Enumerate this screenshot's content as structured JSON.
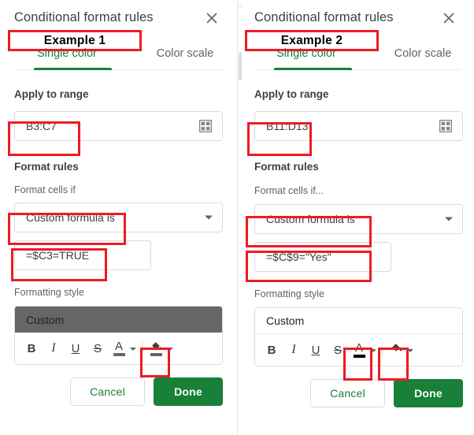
{
  "panels": [
    {
      "id": "example-1",
      "title": "Conditional format rules",
      "close_icon": "close-icon",
      "callout": "Example 1",
      "tabs": [
        {
          "label": "Single color",
          "active": true
        },
        {
          "label": "Color scale",
          "active": false
        }
      ],
      "apply_to_range": {
        "label": "Apply to range",
        "value": "B3:C7",
        "picker_icon": "grid-picker-icon"
      },
      "format_rules": {
        "heading": "Format rules",
        "condition_label": "Format cells if",
        "condition_value": "Custom formula is",
        "formula_value": "=$C3=TRUE"
      },
      "formatting_style": {
        "label": "Formatting style",
        "preview_text": "Custom",
        "preview_bg": "#666666",
        "preview_fg": "#202124",
        "tools": [
          "B",
          "I",
          "U",
          "S"
        ],
        "text_color_icon": "text-color-icon",
        "text_color_swatch": "#666666",
        "fill_color_icon": "fill-color-icon",
        "fill_color_swatch": "#666666"
      },
      "buttons": {
        "cancel": "Cancel",
        "done": "Done"
      }
    },
    {
      "id": "example-2",
      "title": "Conditional format rules",
      "close_icon": "close-icon",
      "callout": "Example 2",
      "tabs": [
        {
          "label": "Single color",
          "active": true
        },
        {
          "label": "Color scale",
          "active": false
        }
      ],
      "apply_to_range": {
        "label": "Apply to range",
        "value": "B11:D13",
        "picker_icon": "grid-picker-icon"
      },
      "format_rules": {
        "heading": "Format rules",
        "condition_label": "Format cells if...",
        "condition_value": "Custom formula is",
        "formula_value": "=$C$9=\"Yes\""
      },
      "formatting_style": {
        "label": "Formatting style",
        "preview_text": "Custom",
        "preview_bg": "#ffffff",
        "preview_fg": "#202124",
        "tools": [
          "B",
          "I",
          "U",
          "S"
        ],
        "text_color_icon": "text-color-icon",
        "text_color_swatch": "#000000",
        "fill_color_icon": "fill-color-icon",
        "fill_color_swatch": "#ffffff"
      },
      "buttons": {
        "cancel": "Cancel",
        "done": "Done"
      }
    }
  ],
  "colors": {
    "annotation": "#ec1c24",
    "accent_green": "#188038",
    "text_primary": "#3c4043",
    "text_secondary": "#5f6368",
    "border": "#dadce0"
  }
}
